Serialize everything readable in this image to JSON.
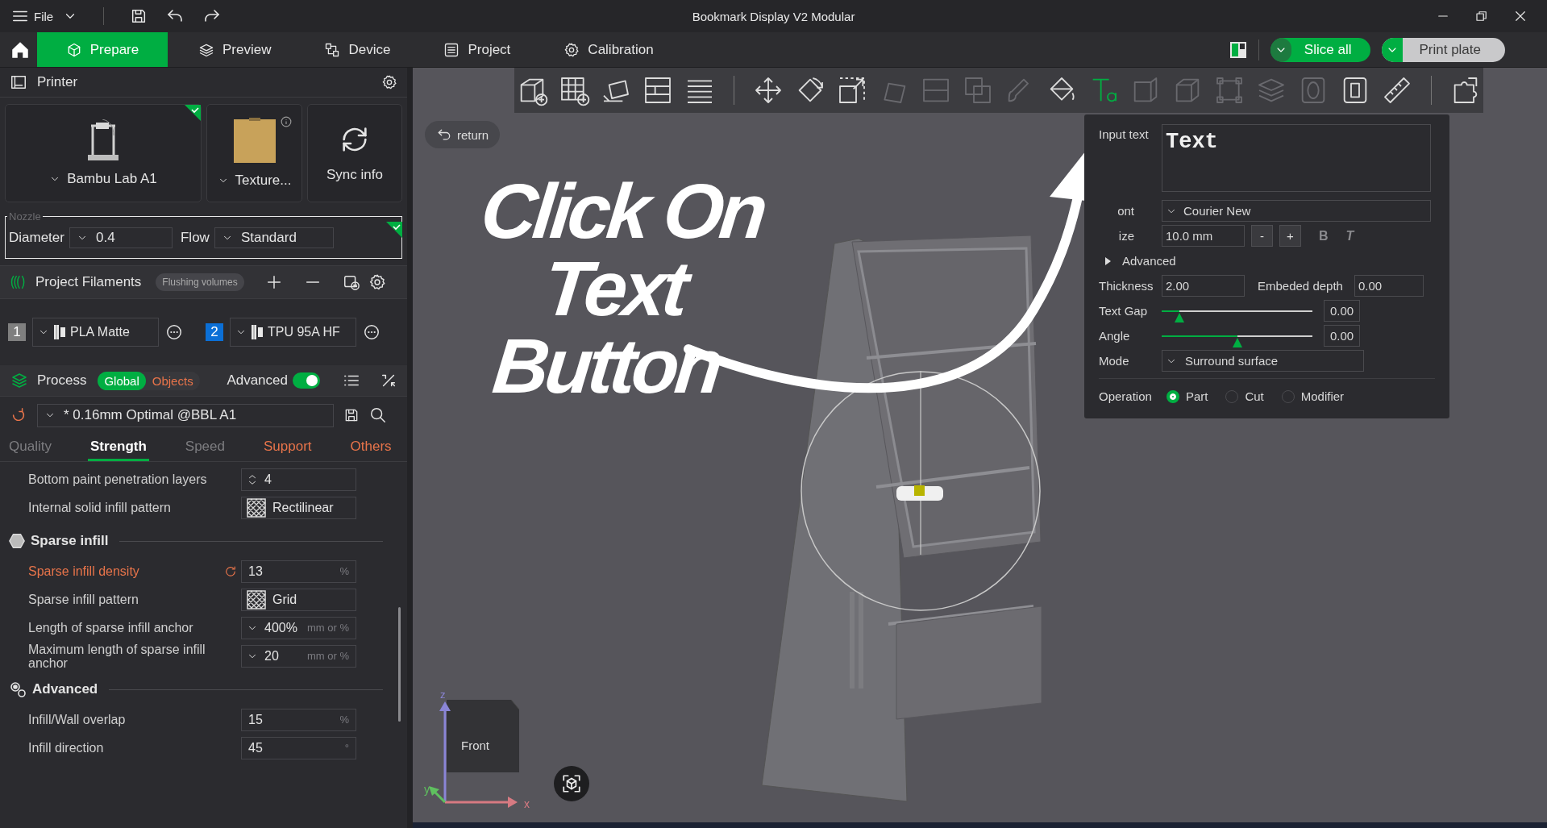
{
  "window": {
    "menu": "File",
    "title": "Bookmark Display V2 Modular"
  },
  "tabs": [
    {
      "label": "Prepare",
      "selected": true
    },
    {
      "label": "Preview",
      "selected": false
    },
    {
      "label": "Device",
      "selected": false
    },
    {
      "label": "Project",
      "selected": false
    },
    {
      "label": "Calibration",
      "selected": false
    }
  ],
  "actions": [
    {
      "label": "Slice all",
      "primary": true
    },
    {
      "label": "Print plate",
      "primary": false
    }
  ],
  "printer": {
    "title": "Printer",
    "cards": [
      {
        "kind": "printer",
        "label": "Bambu Lab A1",
        "synced": true
      },
      {
        "kind": "plate",
        "label": "Texture...",
        "synced": false
      },
      {
        "kind": "sync",
        "label": "Sync info",
        "synced": false
      }
    ],
    "nozzle": {
      "legend": "Nozzle",
      "diameter_label": "Diameter",
      "diameter": "0.4",
      "flow_label": "Flow",
      "flow": "Standard",
      "synced": true
    }
  },
  "filaments": {
    "title": "Project Filaments",
    "flushing": "Flushing volumes",
    "items": [
      {
        "number": "1",
        "name": "PLA Matte",
        "color": "#7f7f7f"
      },
      {
        "number": "2",
        "name": "TPU 95A HF",
        "color": "#0b6fd6"
      }
    ]
  },
  "process": {
    "title": "Process",
    "scopes": [
      {
        "label": "Global",
        "selected": true
      },
      {
        "label": "Objects",
        "selected": false
      }
    ],
    "advanced_label": "Advanced",
    "advanced": true,
    "preset": "* 0.16mm Optimal @BBL A1",
    "preset_modified": true,
    "tabs": [
      {
        "label": "Quality",
        "selected": false,
        "modified": false
      },
      {
        "label": "Strength",
        "selected": true,
        "modified": false
      },
      {
        "label": "Speed",
        "selected": false,
        "modified": false
      },
      {
        "label": "Support",
        "selected": false,
        "modified": true
      },
      {
        "label": "Others",
        "selected": false,
        "modified": true
      }
    ],
    "sections": [
      {
        "kind": "plain",
        "rows": [
          {
            "kind": "spin",
            "label": "Bottom paint penetration layers",
            "value": "4",
            "modified": false
          },
          {
            "kind": "pattern",
            "label": "Internal solid infill pattern",
            "value": "Rectilinear",
            "modified": false
          }
        ]
      },
      {
        "kind": "infill",
        "title": "Sparse infill",
        "rows": [
          {
            "kind": "number",
            "label": "Sparse infill density",
            "value": "13",
            "unit": "%",
            "modified": true
          },
          {
            "kind": "pattern",
            "label": "Sparse infill pattern",
            "value": "Grid",
            "modified": false
          },
          {
            "kind": "dropdown",
            "label": "Length of sparse infill anchor",
            "value": "400%",
            "unit": "mm or %",
            "modified": false
          },
          {
            "kind": "dropdown",
            "label": "Maximum length of sparse infill anchor",
            "value": "20",
            "unit": "mm or %",
            "modified": false
          }
        ]
      },
      {
        "kind": "advanced",
        "title": "Advanced",
        "rows": [
          {
            "kind": "number",
            "label": "Infill/Wall overlap",
            "value": "15",
            "unit": "%",
            "modified": false
          },
          {
            "kind": "number",
            "label": "Infill direction",
            "value": "45",
            "unit": "°",
            "modified": false
          }
        ]
      }
    ]
  },
  "viewport": {
    "return": "return",
    "annotation": "Click On Text Button",
    "toolbar": {
      "groups": [
        [
          {
            "selected": false,
            "disabled": false
          },
          {
            "selected": false,
            "disabled": false
          },
          {
            "selected": false,
            "disabled": false
          },
          {
            "selected": false,
            "disabled": false
          },
          {
            "selected": false,
            "disabled": false
          }
        ],
        [
          {
            "selected": false,
            "disabled": false
          },
          {
            "selected": false,
            "disabled": false
          },
          {
            "selected": false,
            "disabled": false
          },
          {
            "selected": false,
            "disabled": true
          },
          {
            "selected": false,
            "disabled": true
          },
          {
            "selected": false,
            "disabled": true
          },
          {
            "selected": false,
            "disabled": true
          },
          {
            "selected": false,
            "disabled": false
          },
          {
            "selected": true,
            "disabled": false
          },
          {
            "selected": false,
            "disabled": true
          },
          {
            "selected": false,
            "disabled": true
          },
          {
            "selected": false,
            "disabled": true
          },
          {
            "selected": false,
            "disabled": true
          },
          {
            "selected": false,
            "disabled": true
          },
          {
            "selected": false,
            "disabled": false
          },
          {
            "selected": false,
            "disabled": false
          }
        ],
        [
          {
            "selected": false,
            "disabled": false
          }
        ]
      ]
    },
    "view_cube": {
      "face": "Front",
      "x": "x",
      "y": "y",
      "z": "z"
    }
  },
  "text_tool": {
    "input_label": "Input text",
    "input": "Text",
    "font_label": "ont",
    "font": "Courier New",
    "size_label": "ize",
    "size": "10.0 mm",
    "minus": "-",
    "plus": "+",
    "bold": "B",
    "italic": "T",
    "advanced": "Advanced",
    "advanced_expanded": false,
    "thickness_label": "Thickness",
    "thickness": "2.00",
    "depth_label": "Embeded depth",
    "depth": "0.00",
    "sliders": [
      {
        "label": "Text Gap",
        "level": 0.12,
        "value": "0.00"
      },
      {
        "label": "Angle",
        "level": 0.5,
        "value": "0.00"
      }
    ],
    "mode_label": "Mode",
    "mode": "Surround surface",
    "operation_label": "Operation",
    "operations": [
      {
        "label": "Part",
        "selected": true
      },
      {
        "label": "Cut",
        "selected": false
      },
      {
        "label": "Modifier",
        "selected": false
      }
    ]
  }
}
